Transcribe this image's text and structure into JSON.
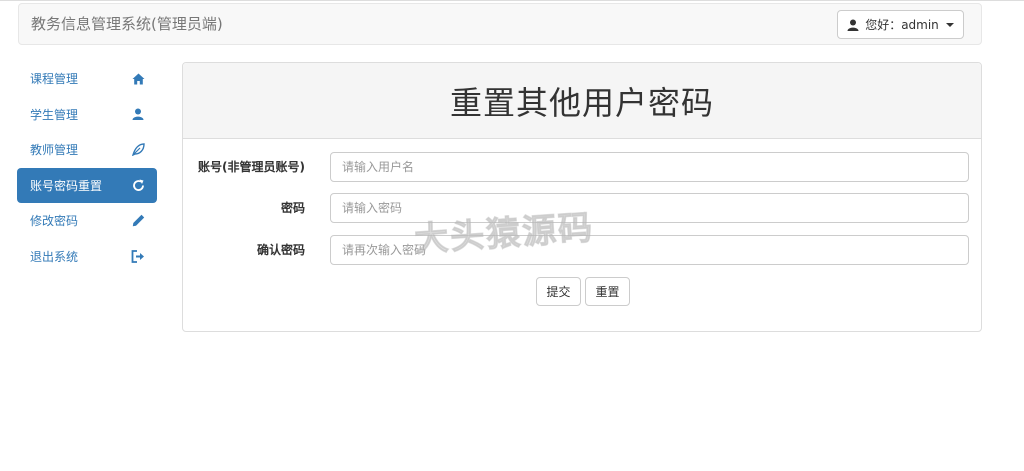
{
  "navbar": {
    "brand": "教务信息管理系统(管理员端)",
    "user_greeting": "您好：admin",
    "user_icon": "user-icon"
  },
  "sidebar": {
    "items": [
      {
        "label": "课程管理",
        "icon": "home-icon",
        "active": false
      },
      {
        "label": "学生管理",
        "icon": "user-icon",
        "active": false
      },
      {
        "label": "教师管理",
        "icon": "leaf-icon",
        "active": false
      },
      {
        "label": "账号密码重置",
        "icon": "refresh-icon",
        "active": true
      },
      {
        "label": "修改密码",
        "icon": "pencil-icon",
        "active": false
      },
      {
        "label": "退出系统",
        "icon": "logout-icon",
        "active": false
      }
    ]
  },
  "main": {
    "title": "重置其他用户密码",
    "fields": [
      {
        "label": "账号(非管理员账号)",
        "placeholder": "请输入用户名",
        "value": ""
      },
      {
        "label": "密码",
        "placeholder": "请输入密码",
        "value": ""
      },
      {
        "label": "确认密码",
        "placeholder": "请再次输入密码",
        "value": ""
      }
    ],
    "submit_label": "提交",
    "reset_label": "重置"
  },
  "watermark": "大头猿源码",
  "colors": {
    "accent": "#337ab7",
    "navbar_bg": "#f8f8f8",
    "panel_heading_bg": "#f5f5f5",
    "border": "#dddddd"
  }
}
